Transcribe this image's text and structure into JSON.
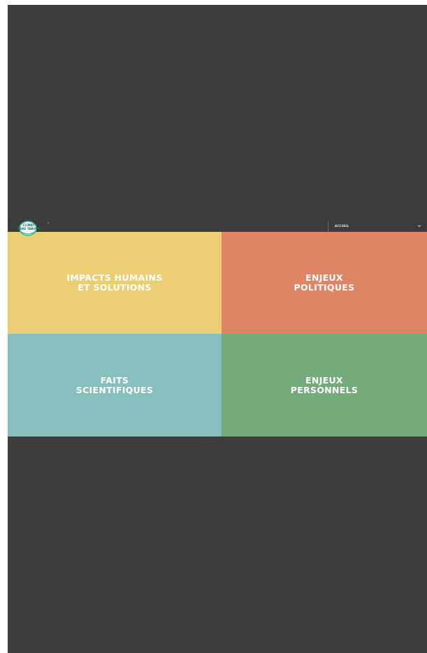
{
  "header": {
    "logo_text_line1": "CLIMAT",
    "logo_text_line2": "SANS TABOUS",
    "nav_label": "ACCUEIL",
    "chevron_icon": "chevron-down-icon"
  },
  "tiles": [
    {
      "label": "IMPACTS HUMAINS\nET SOLUTIONS",
      "color": "#ebce73"
    },
    {
      "label": "ENJEUX\nPOLITIQUES",
      "color": "#de8565"
    },
    {
      "label": "FAITS\nSCIENTIFIQUES",
      "color": "#86bfbe"
    },
    {
      "label": "ENJEUX\nPERSONNELS",
      "color": "#75ab7b"
    }
  ],
  "colors": {
    "background": "#3d3d3d",
    "logo_ring": "#2fb6a5",
    "logo_text": "#0d6b63"
  }
}
